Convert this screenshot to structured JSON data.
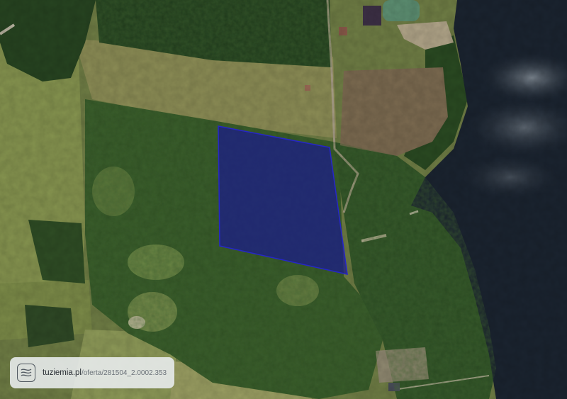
{
  "map": {
    "type": "satellite",
    "parcel_highlight_color": "#1a1a8c",
    "water_color": "#1b2430"
  },
  "attribution": {
    "domain": "tuziemia.pl",
    "path": "/oferta/281504_2.0002.353",
    "icon": "contour-map-logo-icon"
  }
}
